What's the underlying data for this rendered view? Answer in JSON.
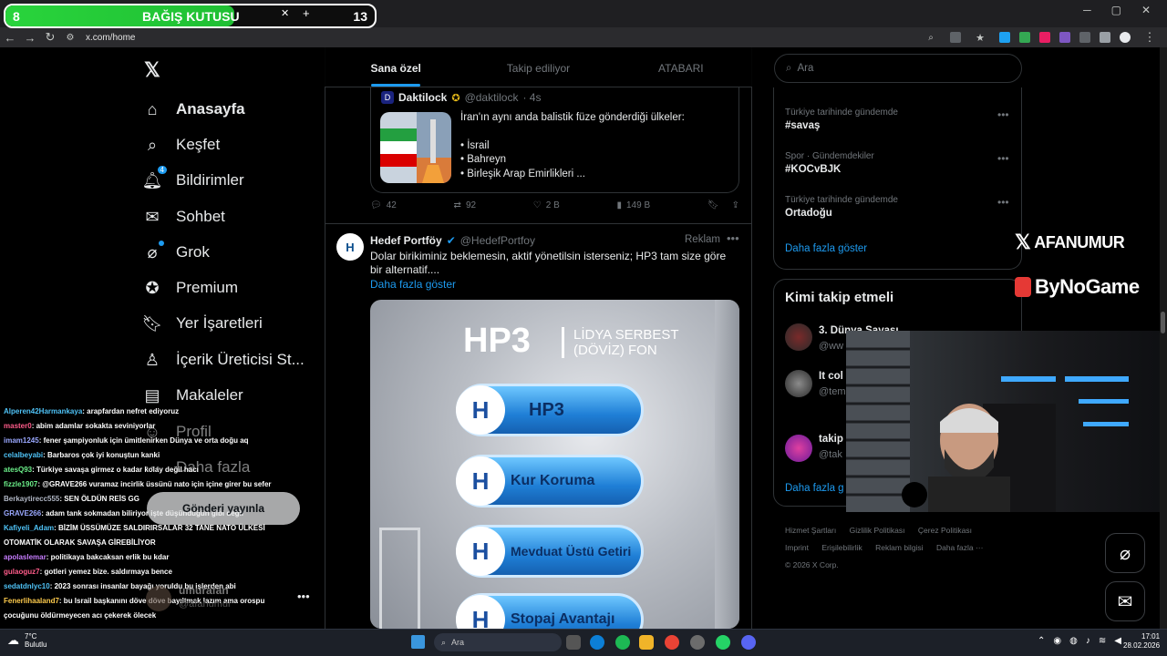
{
  "browser": {
    "url": "x.com/home",
    "window_controls": [
      "─",
      "▢",
      "✕"
    ]
  },
  "donation": {
    "left_number": "8",
    "title": "BAĞIŞ KUTUSU",
    "right_number": "13",
    "progress": 0.62
  },
  "sidebar": {
    "logo": "𝕏",
    "items": [
      {
        "label": "Anasayfa",
        "icon": "home-icon"
      },
      {
        "label": "Keşfet",
        "icon": "search-icon"
      },
      {
        "label": "Bildirimler",
        "icon": "bell-icon",
        "badge": "4"
      },
      {
        "label": "Sohbet",
        "icon": "mail-icon"
      },
      {
        "label": "Grok",
        "icon": "grok-icon"
      },
      {
        "label": "Premium",
        "icon": "premium-icon"
      },
      {
        "label": "Yer İşaretleri",
        "icon": "bookmark-icon"
      },
      {
        "label": "İçerik Üreticisi St...",
        "icon": "creator-icon"
      },
      {
        "label": "Makaleler",
        "icon": "article-icon"
      },
      {
        "label": "Profil",
        "icon": "profile-icon"
      },
      {
        "label": "Daha fazla",
        "icon": "more-icon"
      }
    ],
    "post_button": "Gönderi yayınla",
    "profile": {
      "name": "umurafan",
      "handle": "@afanumur"
    }
  },
  "chat": [
    {
      "user": "Alperen42Harmankaya",
      "color": "#4fc3f7",
      "text": ": arapfardan nefret ediyoruz"
    },
    {
      "user": "master0",
      "color": "#ff5c8a",
      "text": ": abim adamlar sokakta seviniyorlar"
    },
    {
      "user": "imam1245",
      "color": "#9aa8ff",
      "text": ": fener şampiyonluk için ümitlenirken Dünya ve orta doğu aq"
    },
    {
      "user": "celalbeyabi",
      "color": "#4fc3f7",
      "text": ": Barbaros çok iyi konuştun kanki"
    },
    {
      "user": "atesQ93",
      "color": "#6cf08a",
      "text": ": Türkiye savaşa girmez o kadar kolay değil hacı"
    },
    {
      "user": "fizzle1907",
      "color": "#6cf08a",
      "text": ": @GRAVE266 vuramaz incirlik üssünü nato için içine girer bu sefer"
    },
    {
      "user": "Berkaytirecc555",
      "color": "#b0b6c4",
      "text": ": SEN ÖLDÜN REİS GG"
    },
    {
      "user": "GRAVE266",
      "color": "#9aa8ff",
      "text": ": adam tank sokmadan biliriyor işte düşündüğün gibi değil"
    },
    {
      "user": "Kafiyeli_Adam",
      "color": "#4fc3f7",
      "text": ": BİZİM ÜSSÜMÜZE SALDIRIRSALAR 32 TANE NATO ÜLKESİ OTOMATİK OLARAK SAVAŞA GİREBİLİYOR"
    },
    {
      "user": "apolaslemar",
      "color": "#c77dff",
      "text": ": politikaya bakcaksan erlik bu kdar"
    },
    {
      "user": "gulaoguz7",
      "color": "#ff5c8a",
      "text": ": gotleri yemez bize. saldırmaya bence"
    },
    {
      "user": "sedatdnlyc10",
      "color": "#4fc3f7",
      "text": ": 2023 sonrası insanlar bayağı yoruldu bu işlerden abi"
    },
    {
      "user": "Fenerlihaaland7",
      "color": "#ffcc4d",
      "text": ": bu Israil başkanını döve döve bayıltmak lazım ama orospu çocuğunu öldürmeyecen acı çekerek ölecek"
    }
  ],
  "feed": {
    "tabs": [
      "Sana özel",
      "Takip ediliyor",
      "ATABARI"
    ],
    "quote": {
      "author": "Daktilock",
      "handle": "@daktilock",
      "time": "· 4s",
      "title": "İran'ın aynı anda balistik füze gönderdiği ülkeler:",
      "items": [
        "• İsrail",
        "• Bahreyn",
        "• Birleşik Arap Emirlikleri ..."
      ]
    },
    "actions": {
      "reply": "42",
      "retweet": "92",
      "like": "2 B",
      "views": "149 B"
    },
    "tweet2": {
      "name": "Hedef Portföy",
      "handle": "@HedefPortfoy",
      "ad_label": "Reklam",
      "text": "Dolar birikiminiz beklemesin, aktif yönetilsin isterseniz; HP3 tam size göre bir alternatif....",
      "more": "Daha fazla göster",
      "avatar_letter": "H"
    },
    "ad": {
      "title": "HP3",
      "subtitle_1": "LİDYA SERBEST",
      "subtitle_2": "(DÖVİZ) FON",
      "pills": [
        "HP3",
        "Kur Koruma",
        "Mevduat Üstü Getiri",
        "Stopaj Avantajı"
      ]
    }
  },
  "right": {
    "search_placeholder": "Ara",
    "trends": [
      {
        "context": "Türkiye tarihinde gündemde",
        "name": "#savaş"
      },
      {
        "context": "Spor · Gündemdekiler",
        "name": "#KOCvBJK"
      },
      {
        "context": "Türkiye tarihinde gündemde",
        "name": "Ortadoğu"
      }
    ],
    "trends_more": "Daha fazla göster",
    "follow_title": "Kimi takip etmeli",
    "follow": [
      {
        "name": "3. Dünya Savaşı",
        "handle": "@ww"
      },
      {
        "name": "It col",
        "handle": "@tem"
      },
      {
        "name": "takip",
        "handle": "@tak"
      }
    ],
    "follow_more": "Daha fazla g",
    "footer": [
      "Hizmet Şartları",
      "Gizlilik Politikası",
      "Çerez Politikası",
      "Imprint",
      "Erişilebilirlik",
      "Reklam bilgisi",
      "Daha fazla ···",
      "© 2026 X Corp."
    ]
  },
  "overlays": {
    "brand1": "AFANUMUR",
    "brand2": "ByNoGame"
  },
  "taskbar": {
    "temp": "7°C",
    "weather": "Bulutlu",
    "search": "Ara",
    "time": "17:01",
    "date": "28.02.2026"
  }
}
